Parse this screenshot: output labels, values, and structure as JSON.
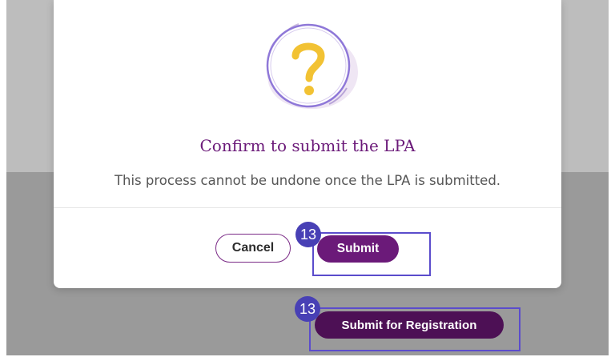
{
  "dialog": {
    "title": "Confirm to submit the LPA",
    "message": "This process cannot be undone once the LPA is submitted.",
    "cancel_label": "Cancel",
    "submit_label": "Submit",
    "icon": "question-icon"
  },
  "page": {
    "submit_for_registration_label": "Submit for Registration"
  },
  "annotations": {
    "submit_step": "13",
    "submit_for_registration_step": "13"
  },
  "colors": {
    "brand_purple": "#6b1a79",
    "dark_purple": "#4d1055",
    "annotation": "#4840b5",
    "question_mark": "#f2c233"
  }
}
